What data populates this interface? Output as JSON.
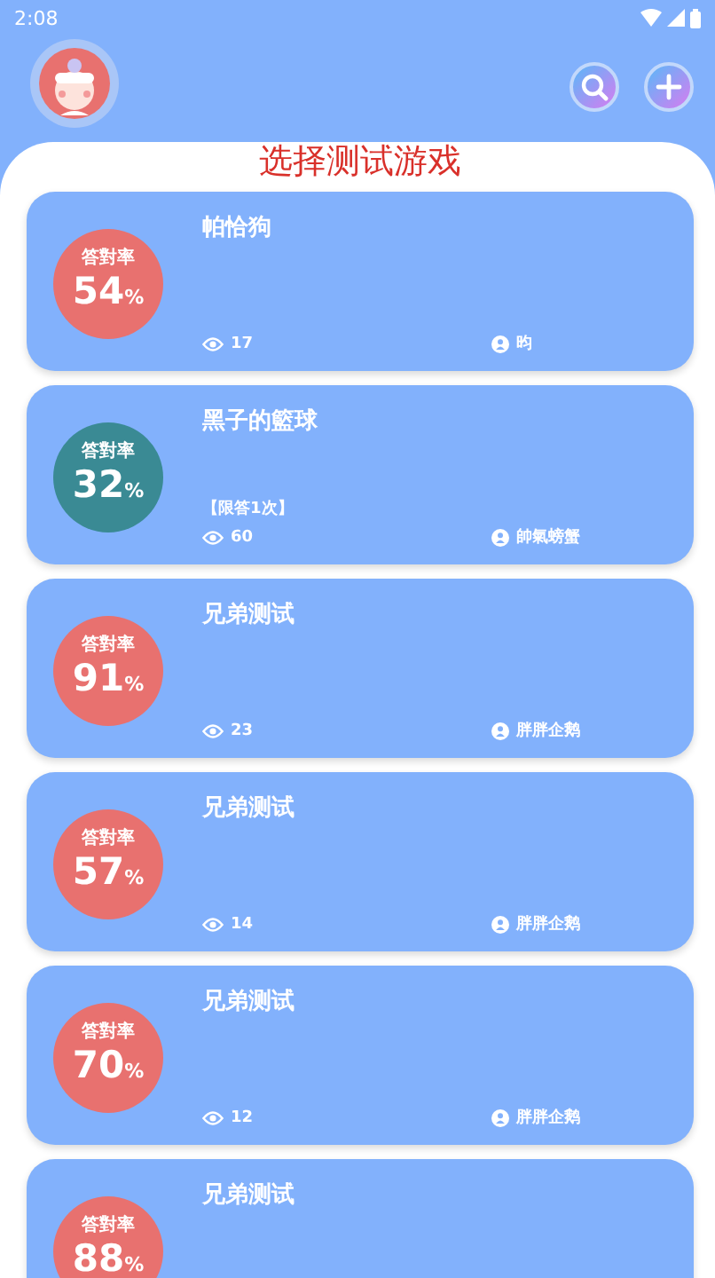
{
  "status_bar": {
    "time": "2:08"
  },
  "header": {
    "title": "选择测试游戏"
  },
  "cards": [
    {
      "title": "帕恰狗",
      "rate_label": "答對率",
      "percent": "54",
      "unit": "%",
      "color": "#e8716f",
      "views": "17",
      "author": "昀"
    },
    {
      "title": "黑子的籃球",
      "rate_label": "答對率",
      "percent": "32",
      "unit": "%",
      "color": "#3a8a94",
      "tag": "【限答1次】",
      "views": "60",
      "author": "帥氣螃蟹"
    },
    {
      "title": "兄弟测试",
      "rate_label": "答對率",
      "percent": "91",
      "unit": "%",
      "color": "#e8716f",
      "views": "23",
      "author": "胖胖企鹅"
    },
    {
      "title": "兄弟测试",
      "rate_label": "答對率",
      "percent": "57",
      "unit": "%",
      "color": "#e8716f",
      "views": "14",
      "author": "胖胖企鹅"
    },
    {
      "title": "兄弟测试",
      "rate_label": "答對率",
      "percent": "70",
      "unit": "%",
      "color": "#e8716f",
      "views": "12",
      "author": "胖胖企鹅"
    },
    {
      "title": "兄弟测试",
      "rate_label": "答對率",
      "percent": "88",
      "unit": "%",
      "color": "#e8716f"
    }
  ]
}
